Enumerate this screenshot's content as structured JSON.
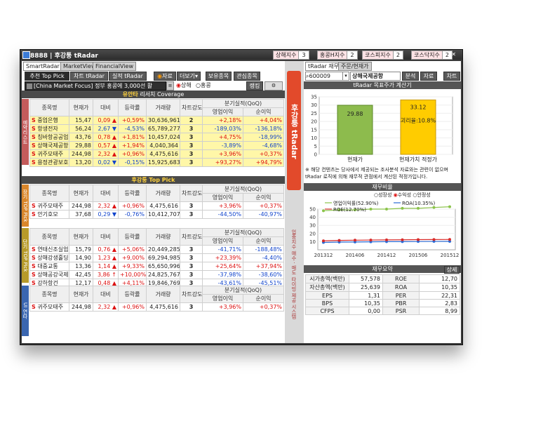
{
  "window": {
    "title": "8888 | 후강퉁 tRadar"
  },
  "left_tabs": [
    "SmartRadar",
    "MarketView",
    "FinancialView"
  ],
  "toolbar": {
    "top_pick": "추천 Top Pick",
    "chart": "차트 tRadar",
    "perf": "실적 tRadar",
    "rss": "자료",
    "more": "더보기",
    "holdings": "보유종목",
    "watch": "관심종목"
  },
  "ticker": {
    "text": "[China Market Focus] 정부 홍콩에 3,000선 활",
    "ranking": "랭킹",
    "radio1": "상해",
    "radio2": "홍콩"
  },
  "coverage": {
    "title_strong": "유안타",
    "title_rest": " 리서치 Coverage",
    "side_label": "예약리스트",
    "headers": [
      "종목명",
      "현재가",
      "대비",
      "등락률",
      "거래량",
      "차트강도",
      "분기실적(QoQ)",
      "영업이익",
      "순이익"
    ],
    "rows": [
      {
        "name": "중업은행",
        "price": "15,47",
        "change": "0,09",
        "dir": "up",
        "rate": "+0,59%",
        "volume": "30,636,961",
        "strength": "2",
        "op": "+2,18%",
        "net": "+4,04%"
      },
      {
        "name": "항생전자",
        "price": "56,24",
        "change": "2,67",
        "dir": "down",
        "rate": "-4,53%",
        "volume": "65,789,277",
        "strength": "3",
        "op": "-189,03%",
        "net": "-136,18%"
      },
      {
        "name": "칭바항공공업",
        "price": "43,76",
        "change": "0,78",
        "dir": "up",
        "rate": "+1,81%",
        "volume": "10,457,024",
        "strength": "3",
        "op": "+4,75%",
        "net": "-18,99%"
      },
      {
        "name": "상해국제공항",
        "price": "29,88",
        "change": "0,57",
        "dir": "up",
        "rate": "+1,94%",
        "volume": "4,040,364",
        "strength": "3",
        "op": "-3,89%",
        "net": "-4,68%"
      },
      {
        "name": "귀주모태주",
        "price": "244,98",
        "change": "2,32",
        "dir": "up",
        "rate": "+0,96%",
        "volume": "4,475,616",
        "strength": "3",
        "op": "+3,96%",
        "net": "+0,37%"
      },
      {
        "name": "용정관광보호",
        "price": "13,20",
        "change": "0,02",
        "dir": "down",
        "rate": "-0,15%",
        "volume": "15,925,683",
        "strength": "3",
        "op": "+93,27%",
        "net": "+94,79%"
      }
    ]
  },
  "top_pick": {
    "title": "후강퉁 Top Pick",
    "side_label": "장기 TOP Pick",
    "headers": [
      "종목명",
      "현재가",
      "대비",
      "등락률",
      "거래량",
      "차트강도",
      "분기실적(QoQ)",
      "영업이익",
      "순이익"
    ],
    "rows": [
      {
        "name": "귀주모태주",
        "price": "244,98",
        "change": "2,32",
        "dir": "up",
        "rate": "+0,96%",
        "volume": "4,475,616",
        "strength": "3",
        "op": "+3,96%",
        "net": "+0,37%"
      },
      {
        "name": "안기호모",
        "price": "37,68",
        "change": "0,29",
        "dir": "down",
        "rate": "-0,76%",
        "volume": "10,412,707",
        "strength": "3",
        "op": "-44,50%",
        "net": "-40,97%"
      }
    ]
  },
  "short_pick": {
    "side_label": "단기 TOP Pick",
    "headers": [
      "종목명",
      "현재가",
      "대비",
      "등락률",
      "거래량",
      "차트강도",
      "분기실적(QoQ)",
      "영업이익",
      "순이익"
    ],
    "rows": [
      {
        "name": "연태신조실업",
        "price": "15,79",
        "change": "0,76",
        "dir": "up",
        "rate": "+5,06%",
        "volume": "20,449,285",
        "strength": "3",
        "op": "-41,71%",
        "net": "-188,48%"
      },
      {
        "name": "상해강생홀딩",
        "price": "14,90",
        "change": "1,23",
        "dir": "up",
        "rate": "+9,00%",
        "volume": "69,294,985",
        "strength": "3",
        "op": "+23,39%",
        "net": "-4,40%"
      },
      {
        "name": "대중교통",
        "price": "13,36",
        "change": "1,14",
        "dir": "up",
        "rate": "+9,33%",
        "volume": "65,650,996",
        "strength": "3",
        "op": "+25,64%",
        "net": "+37,94%"
      },
      {
        "name": "상해공강국제",
        "price": "42,45",
        "change": "3,86",
        "dir": "up2",
        "rate": "+10,00%",
        "volume": "24,825,767",
        "strength": "3",
        "op": "-37,98%",
        "net": "-38,60%"
      },
      {
        "name": "강하항건",
        "price": "12,17",
        "change": "0,48",
        "dir": "up",
        "rate": "+4,11%",
        "volume": "19,846,769",
        "strength": "3",
        "op": "-43,61%",
        "net": "-45,51%"
      }
    ]
  },
  "ui_pick": {
    "side_label": "UI 연타",
    "headers": [
      "종목명",
      "현재가",
      "대비",
      "등락률",
      "거래량",
      "차트강도",
      "분기실적(QoQ)",
      "영업이익",
      "순이익"
    ],
    "rows": [
      {
        "name": "귀주모태주",
        "price": "244,98",
        "change": "2,32",
        "dir": "up",
        "rate": "+0,96%",
        "volume": "4,475,616",
        "strength": "3",
        "op": "+3,96%",
        "net": "+0,37%"
      }
    ]
  },
  "separator": {
    "big": "후강퉁 tRadar",
    "small": "업종지수 매수 · 매도 타이밍 제공 시스템"
  },
  "indices": [
    {
      "name": "상해지수",
      "value": "3"
    },
    {
      "name": "홍콩H지수",
      "value": "2"
    },
    {
      "name": "코스피지수",
      "value": "2"
    },
    {
      "name": "코스닥지수",
      "value": "2"
    }
  ],
  "right_tabs": [
    "tRadar 재무",
    "주문/현재가"
  ],
  "stock": {
    "code": "600009",
    "name": "상해국제공항",
    "btn_analyze": "분석",
    "btn_data": "자료",
    "btn_chart": "차트"
  },
  "target_price": {
    "title": "tRadar 목표주가 계산기",
    "current_label": "현재가",
    "fair_label": "현재가치 적정가",
    "current_value": "29.88",
    "fair_value": "33.12",
    "gap_text": "괴리율:10.8%",
    "current_num": 29.88,
    "fair_num": 33.12,
    "ymax": 35,
    "yticks": [
      0,
      5,
      10,
      15,
      20,
      25,
      30,
      35
    ],
    "note": "※ 해당 컨텐츠는 당사에서 제공되는 조사분석 자료와는 관련이 없으며 tRadar 로직에 의해 재무적 관점에서 계산된 적정가입니다."
  },
  "ratio": {
    "title": "재무비율",
    "radios": [
      "성장성",
      "수익성",
      "안정성"
    ],
    "legend_op": "영업이익률(52.90%)",
    "legend_roa": "ROA(10.35%)",
    "legend_roe": "ROE(12.70%)",
    "chart_data": {
      "type": "line",
      "x": [
        "201312",
        "201406",
        "201412",
        "201506",
        "201512"
      ],
      "ylim": [
        0,
        50
      ],
      "yticks": [
        10,
        20,
        30,
        40,
        50
      ],
      "series": [
        {
          "name": "영업이익률(52.90%)",
          "values": [
            48,
            49,
            49,
            50,
            50,
            51,
            51,
            52,
            52.9
          ],
          "color": "#8bc34a"
        },
        {
          "name": "ROA(10.35%)",
          "values": [
            9,
            9.5,
            9.6,
            9.8,
            10,
            10,
            10.2,
            10.3,
            10.35
          ],
          "color": "#2a6bd6"
        },
        {
          "name": "ROE(12.70%)",
          "values": [
            11,
            11.5,
            11.8,
            12,
            12.2,
            12.3,
            12.5,
            12.6,
            12.7
          ],
          "color": "#d62a2a"
        }
      ]
    }
  },
  "summary": {
    "title": "재무요약",
    "btn": "상세",
    "rows": [
      [
        "시가총액(백만)",
        "57,578",
        "ROE",
        "12,70"
      ],
      [
        "자산총액(백만)",
        "25,639",
        "ROA",
        "10,35"
      ],
      [
        "EPS",
        "1,31",
        "PER",
        "22,31"
      ],
      [
        "BPS",
        "10,35",
        "PBR",
        "2,83"
      ],
      [
        "CFPS",
        "0,00",
        "PSR",
        "8,99"
      ]
    ]
  }
}
